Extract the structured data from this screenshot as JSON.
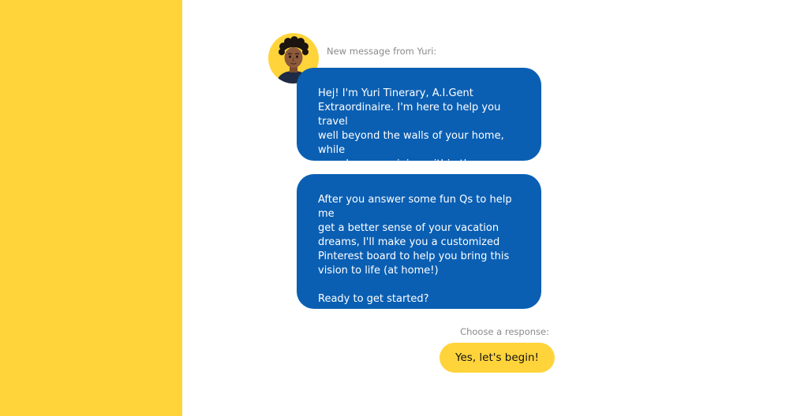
{
  "colors": {
    "accent_yellow": "#FFD43B",
    "bubble_blue": "#0A5FB3",
    "caption_gray": "#8a8a8a"
  },
  "chat": {
    "sender_caption": "New message from Yuri:",
    "avatar_icon": "person-avatar-icon",
    "messages": [
      {
        "lines": [
          "Hej! I'm Yuri Tinerary, A.I.Gent",
          "Extraordinaire. I'm here to help you travel",
          "well beyond the walls of your home, while",
          "somehow remaining within them."
        ]
      },
      {
        "lines": [
          "After you answer some fun Qs to help me",
          "get a better sense of your vacation",
          "dreams, I'll make you a customized",
          "Pinterest board to help you bring this",
          "vision to life (at home!)"
        ],
        "closing": "Ready to get started?"
      }
    ]
  },
  "response": {
    "prompt": "Choose a response:",
    "options": [
      "Yes, let's begin!"
    ]
  }
}
